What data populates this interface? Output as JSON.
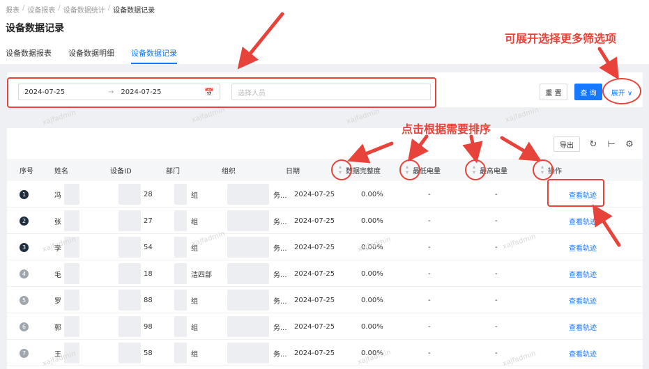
{
  "breadcrumb": [
    "报表",
    "设备报表",
    "设备数据统计",
    "设备数据记录"
  ],
  "breadcrumb_sep": "/",
  "page_title": "设备数据记录",
  "tabs": [
    {
      "label": "设备数据报表",
      "active": false
    },
    {
      "label": "设备数据明细",
      "active": false
    },
    {
      "label": "设备数据记录",
      "active": true
    }
  ],
  "filter": {
    "date_start": "2024-07-25",
    "date_arrow": "→",
    "date_end": "2024-07-25",
    "person_placeholder": "选择人员",
    "reset_label": "重 置",
    "query_label": "查 询",
    "expand_label": "展开 ∨"
  },
  "toolbar": {
    "export_label": "导出"
  },
  "columns": [
    "序号",
    "姓名",
    "设备ID",
    "部门",
    "组织",
    "日期",
    "数据完整度",
    "最低电量",
    "最高电量",
    "操作"
  ],
  "rows": [
    {
      "idx": "1",
      "name": "冯",
      "device": "28",
      "dept": "组",
      "org": "务...",
      "date": "2024-07-25",
      "completeness": "0.00%",
      "min": "-",
      "max": "-",
      "action": "查看轨迹"
    },
    {
      "idx": "2",
      "name": "张",
      "device": "27",
      "dept": "组",
      "org": "务...",
      "date": "2024-07-25",
      "completeness": "0.00%",
      "min": "-",
      "max": "-",
      "action": "查看轨迹"
    },
    {
      "idx": "3",
      "name": "李",
      "device": "54",
      "dept": "组",
      "org": "务...",
      "date": "2024-07-25",
      "completeness": "0.00%",
      "min": "-",
      "max": "-",
      "action": "查看轨迹"
    },
    {
      "idx": "4",
      "name": "毛",
      "device": "18",
      "dept": "洁四部",
      "org": "务...",
      "date": "2024-07-25",
      "completeness": "0.00%",
      "min": "-",
      "max": "-",
      "action": "查看轨迹"
    },
    {
      "idx": "5",
      "name": "罗",
      "device": "88",
      "dept": "组",
      "org": "务...",
      "date": "2024-07-25",
      "completeness": "0.00%",
      "min": "-",
      "max": "-",
      "action": "查看轨迹"
    },
    {
      "idx": "6",
      "name": "郭",
      "device": "98",
      "dept": "组",
      "org": "务...",
      "date": "2024-07-25",
      "completeness": "0.00%",
      "min": "-",
      "max": "-",
      "action": "查看轨迹"
    },
    {
      "idx": "7",
      "name": "王",
      "device": "58",
      "dept": "组",
      "org": "务...",
      "date": "2024-07-25",
      "completeness": "0.00%",
      "min": "-",
      "max": "-",
      "action": "查看轨迹"
    }
  ],
  "watermark_text": "xajfadmin",
  "annotations": {
    "expand_hint": "可展开选择更多筛选项",
    "sort_hint": "点击根据需要排序"
  },
  "colors": {
    "accent": "#1677ff",
    "annotation": "#e8433a",
    "badge_dark": "#1f2d3d",
    "badge_gray": "#a0a6ad"
  }
}
